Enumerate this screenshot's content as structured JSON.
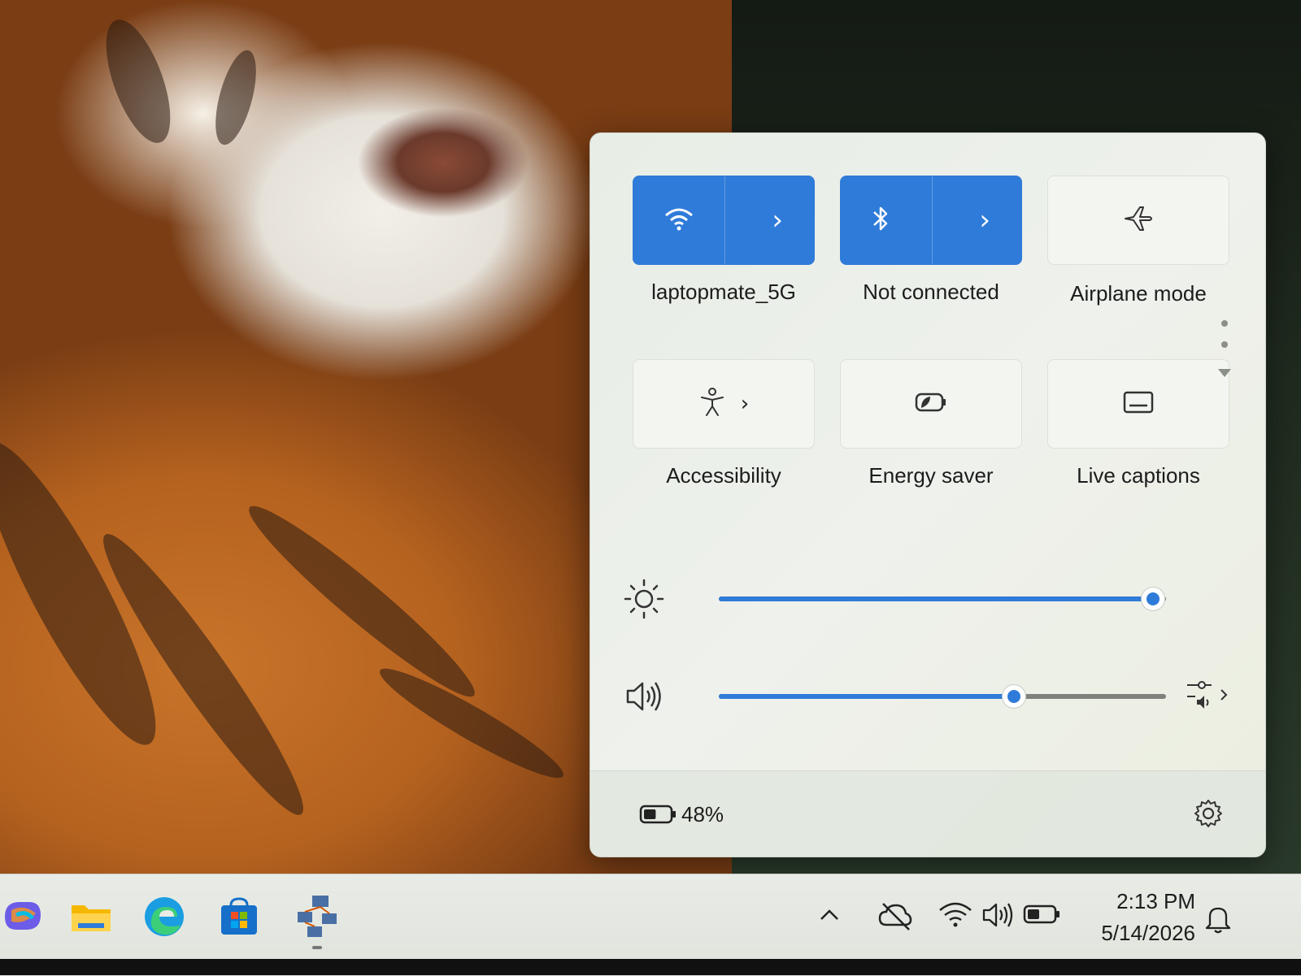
{
  "quick_settings": {
    "tiles": [
      {
        "label": "laptopmate_5G",
        "icon": "wifi-icon",
        "active": true,
        "has_chevron": true
      },
      {
        "label": "Not connected",
        "icon": "bluetooth-icon",
        "active": true,
        "has_chevron": true
      },
      {
        "label": "Airplane mode",
        "icon": "airplane-icon",
        "active": false,
        "has_chevron": false
      },
      {
        "label": "Accessibility",
        "icon": "accessibility-icon",
        "active": false,
        "has_chevron": true
      },
      {
        "label": "Energy saver",
        "icon": "energy-saver-icon",
        "active": false,
        "has_chevron": false
      },
      {
        "label": "Live captions",
        "icon": "live-captions-icon",
        "active": false,
        "has_chevron": false
      }
    ],
    "brightness": {
      "icon": "brightness-icon",
      "level": 0.97
    },
    "volume": {
      "icon": "speaker-icon",
      "level": 0.66,
      "output_icon": "sound-output-icon"
    },
    "battery": {
      "percent": "48%",
      "level": 0.48
    },
    "settings_icon": "gear-icon"
  },
  "taskbar": {
    "apps": [
      "copilot-icon",
      "file-explorer-icon",
      "edge-icon",
      "microsoft-store-icon",
      "network-app-icon"
    ],
    "tray": [
      "chevron-up-icon",
      "cloud-off-icon",
      "wifi-icon",
      "speaker-icon",
      "battery-icon"
    ],
    "time": "2:13 PM",
    "date": "5/14/2026",
    "notification_icon": "notification-bell-icon"
  },
  "colors": {
    "accent": "#2f7bd9",
    "flyout_bg": "#eef1ec"
  }
}
